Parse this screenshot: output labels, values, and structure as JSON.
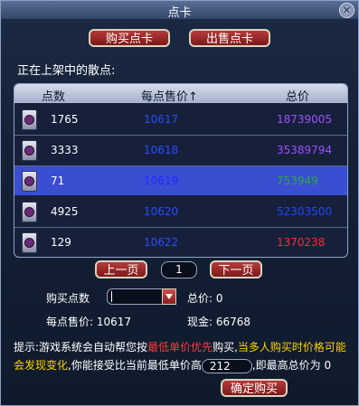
{
  "window": {
    "title": "点卡"
  },
  "tabs": {
    "buy": "购买点卡",
    "sell": "出售点卡"
  },
  "section_label": "正在上架中的散点:",
  "table": {
    "headers": [
      "点数",
      "每点售价↑",
      "总价"
    ],
    "rows": [
      {
        "points": "1765",
        "unit_price": "10617",
        "total": "18739005",
        "total_color": "#a050ff"
      },
      {
        "points": "3333",
        "unit_price": "10618",
        "total": "35389794",
        "total_color": "#a050ff"
      },
      {
        "points": "71",
        "unit_price": "10619",
        "total": "753949",
        "total_color": "#2aa84a"
      },
      {
        "points": "4925",
        "unit_price": "10620",
        "total": "52303500",
        "total_color": "#1c48ff"
      },
      {
        "points": "129",
        "unit_price": "10622",
        "total": "1370238",
        "total_color": "#ff2a2a"
      }
    ],
    "selected_index": 2
  },
  "pagination": {
    "prev": "上一页",
    "page": "1",
    "next": "下一页"
  },
  "form": {
    "buy_points_label": "购买点数",
    "total_label": "总价:",
    "total_value": "0",
    "unit_price_label": "每点售价:",
    "unit_price_value": "10617",
    "cash_label": "现金:",
    "cash_value": "66768"
  },
  "hint": {
    "prefix": "提示:",
    "text1": "游戏系统会自动帮您按",
    "highlight1": "最低单价优先",
    "text2": "购买,",
    "highlight2": "当多人购买时价格可能会发现变化",
    "text3": ",你能接受比当前最低单价高",
    "max_price": "212",
    "text4": ",即最高总价为",
    "max_total": "0"
  },
  "confirm_button": "确定购买",
  "colors": {
    "accent_red": "#9a2020",
    "highlight_red": "#ff3a3a",
    "highlight_yellow": "#ffd200",
    "selection": "#3a4ed2"
  }
}
